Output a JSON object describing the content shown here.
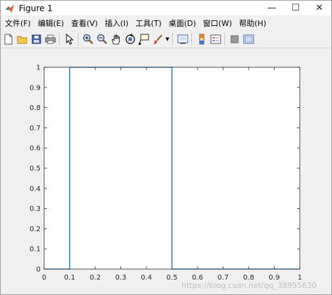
{
  "window": {
    "title": "Figure 1",
    "controls": {
      "minimize": "—",
      "maximize": "☐",
      "close": "✕"
    }
  },
  "menu": [
    "文件(F)",
    "编辑(E)",
    "查看(V)",
    "插入(I)",
    "工具(T)",
    "桌面(D)",
    "窗口(W)",
    "帮助(H)"
  ],
  "toolbar": {
    "buttons": [
      "new-figure",
      "open-file",
      "save",
      "print",
      "edit-plot",
      "zoom-in",
      "zoom-out",
      "pan",
      "rotate-3d",
      "data-cursor",
      "brush",
      "link-plot",
      "insert-colorbar",
      "insert-legend",
      "hide-plot-tools",
      "show-plot-tools"
    ]
  },
  "watermark": "https://blog.csdn.net/qq_38955630",
  "chart_data": {
    "type": "line",
    "x": [
      0,
      0.1,
      0.1,
      0.5,
      0.5,
      1
    ],
    "y": [
      0,
      0,
      1,
      1,
      0,
      0
    ],
    "xlim": [
      0,
      1
    ],
    "ylim": [
      0,
      1
    ],
    "xticks": [
      "0",
      "0.1",
      "0.2",
      "0.3",
      "0.4",
      "0.5",
      "0.6",
      "0.7",
      "0.8",
      "0.9",
      "1"
    ],
    "yticks": [
      "0",
      "0.1",
      "0.2",
      "0.3",
      "0.4",
      "0.5",
      "0.6",
      "0.7",
      "0.8",
      "0.9",
      "1"
    ],
    "grid": false,
    "line_color": "#0072bd"
  }
}
